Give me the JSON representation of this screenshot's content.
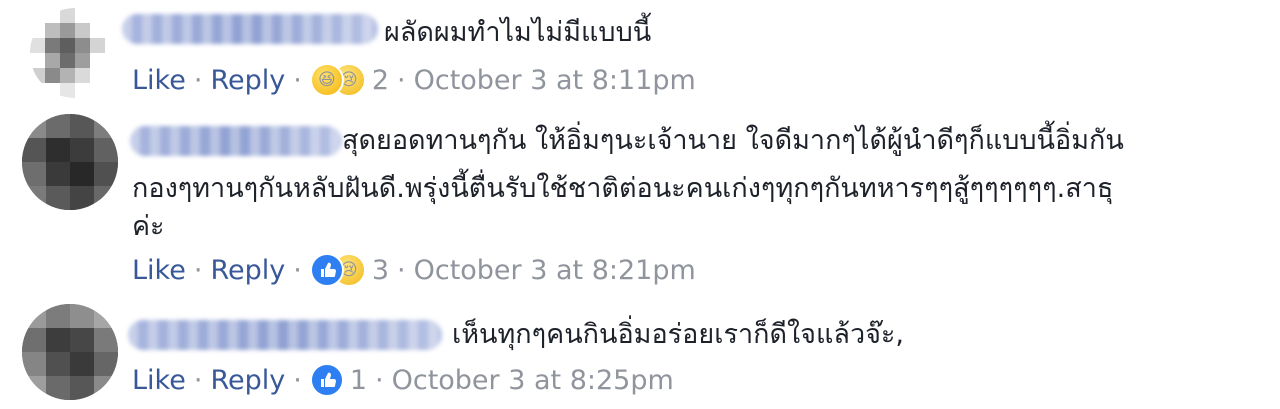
{
  "comments": [
    {
      "text": "ผลัดผมทำไมไม่มีแบบนี้",
      "like_label": "Like",
      "reply_label": "Reply",
      "separator": "·",
      "reactions": [
        "haha-icon",
        "sad-icon"
      ],
      "reaction_count": "2",
      "timestamp": "October 3 at 8:11pm"
    },
    {
      "text_line1": "สุดยอดทานๆกัน ให้อิ่มๆนะเจ้านาย ใจดีมากๆได้ผู้นำดีๆก็แบบนี้อิ่มกัน",
      "text_line2": "กองๆทานๆกันหลับฝันดี.พรุ่งนี้ตื่นรับใช้ชาติต่อนะคนเก่งๆทุกๆกันทหารๆๆสู้ๆๆๆๆๆๆ.สาธุ",
      "text_line3": "ค่ะ",
      "like_label": "Like",
      "reply_label": "Reply",
      "separator": "·",
      "reactions": [
        "like-icon",
        "sad-icon"
      ],
      "reaction_count": "3",
      "timestamp": "October 3 at 8:21pm"
    },
    {
      "text": "เห็นทุกๆคนกินอิ่มอร่อยเราก็ดีใจแล้วจ๊ะ,",
      "like_label": "Like",
      "reply_label": "Reply",
      "separator": "·",
      "reactions": [
        "like-icon"
      ],
      "reaction_count": "1",
      "timestamp": "October 3 at 8:25pm"
    }
  ],
  "colors": {
    "link": "#385898",
    "meta": "#90949c",
    "text": "#1d2129",
    "like_reaction": "#2d7ff2"
  }
}
